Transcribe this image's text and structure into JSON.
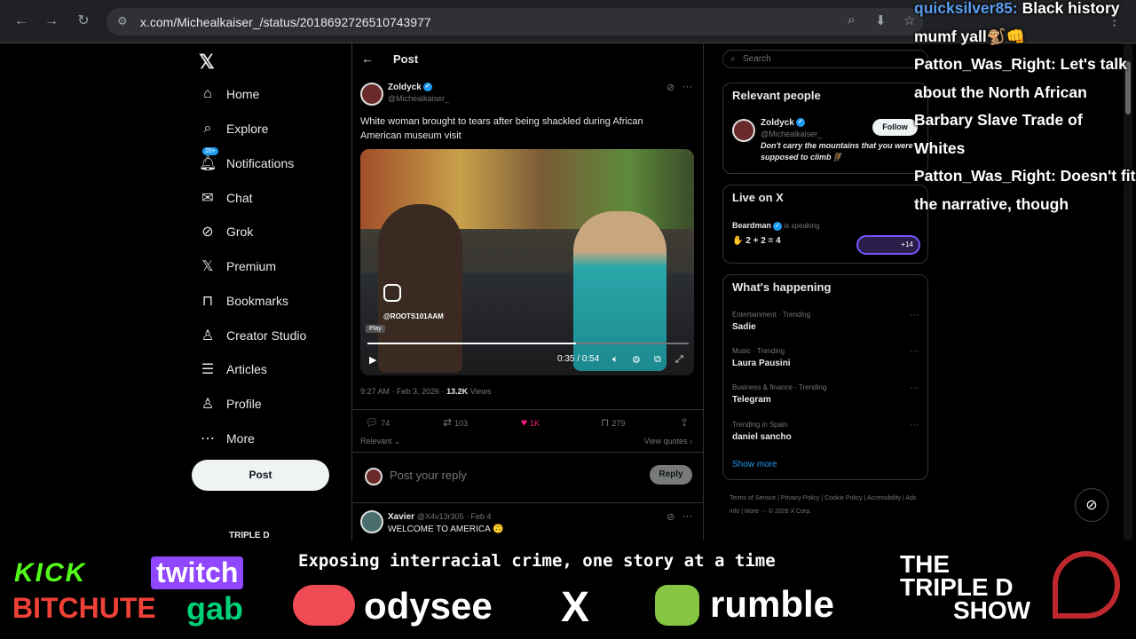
{
  "browser": {
    "url": "x.com/Michealkaiser_/status/2018692726510743977"
  },
  "sidebar": {
    "items": [
      {
        "label": "Home"
      },
      {
        "label": "Explore"
      },
      {
        "label": "Notifications",
        "badge": "20+"
      },
      {
        "label": "Chat"
      },
      {
        "label": "Grok"
      },
      {
        "label": "Premium"
      },
      {
        "label": "Bookmarks"
      },
      {
        "label": "Creator Studio"
      },
      {
        "label": "Articles"
      },
      {
        "label": "Profile"
      },
      {
        "label": "More"
      }
    ],
    "post_label": "Post",
    "account_name": "TRIPLE D"
  },
  "main": {
    "header_title": "Post",
    "tweet": {
      "author": "Zoldyck",
      "handle": "@Michealkaiser_",
      "text": "White woman brought to tears after being shackled during African American museum visit",
      "video": {
        "watermark": "@ROOTS101AAM",
        "play_tip": "Play",
        "time": "0:35 / 0:54",
        "progress": 0.65
      },
      "time": "9:27 AM · Feb 3, 2026 · ",
      "views_count": "13.2K",
      "views_label": " Views",
      "replies": "74",
      "reposts": "103",
      "likes": "1K",
      "bookmarks": "279",
      "relevant": "Relevant ⌄",
      "view_quotes": "View quotes ›"
    },
    "reply": {
      "placeholder": "Post your reply",
      "button": "Reply"
    },
    "next_reply": {
      "name": "Xavier",
      "handle": "@X4v13r305 · Feb 4",
      "text": "WELCOME TO AMERICA 🙃"
    }
  },
  "right": {
    "search_placeholder": "Search",
    "relevant_people": {
      "title": "Relevant people",
      "name": "Zoldyck",
      "handle": "@Michealkaiser_",
      "follow": "Follow",
      "bio": "Don't carry the mountains that you were supposed to climb 🧗"
    },
    "live": {
      "title": "Live on X",
      "host": "Beardman",
      "status": "is speaking",
      "topic": "✋ 2 + 2 = 4",
      "listeners": "+14"
    },
    "happening": {
      "title": "What's happening",
      "trends": [
        {
          "category": "Entertainment · Trending",
          "name": "Sadie"
        },
        {
          "category": "Music · Trending",
          "name": "Laura Pausini"
        },
        {
          "category": "Business & finance · Trending",
          "name": "Telegram"
        },
        {
          "category": "Trending in Spain",
          "name": "daniel sancho"
        }
      ],
      "show_more": "Show more"
    },
    "footer": "Terms of Service  |  Privacy Policy  |  Cookie Policy  |  Accessibility  |  Ads info  |  More ···  © 2026 X Corp."
  },
  "chat": [
    {
      "user": "quicksilver85:",
      "msg": " Black history mumf yall🐒👊"
    },
    {
      "user": "Patton_Was_Right:",
      "msg": " Let's talk about the North African Barbary Slave Trade of Whites"
    },
    {
      "user": "Patton_Was_Right:",
      "msg": " Doesn't fit the narrative, though"
    }
  ],
  "banner": {
    "ticker": "Exposing interracial crime, one story at a time",
    "kick": "KICK",
    "twitch": "twitch",
    "bitchute": "BITCHUTE",
    "gab": "gab",
    "odysee": "odysee",
    "x": "X",
    "rumble": "rumble",
    "show_line1": "THE",
    "show_line2": "TRIPLE D",
    "show_line3": "SHOW"
  },
  "colors": {
    "accent": "#1d9bf0",
    "like": "#f91880",
    "kick": "#53fc18",
    "twitch": "#9146ff",
    "bitchute": "#ef4137",
    "gab": "#00d178",
    "rumble": "#85c742"
  }
}
